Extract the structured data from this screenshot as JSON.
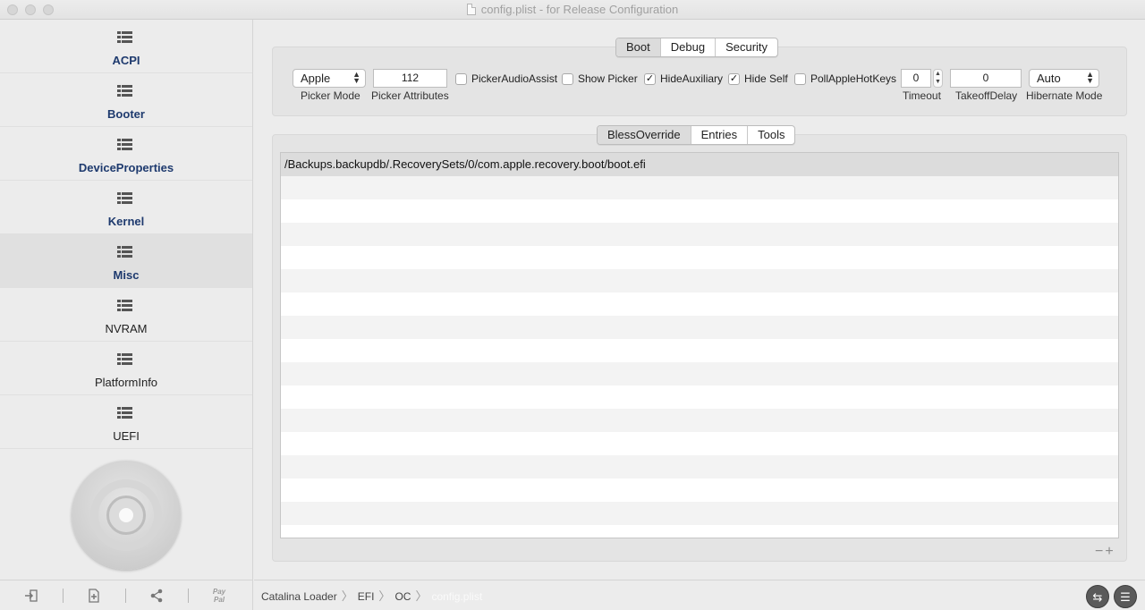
{
  "window": {
    "title": "config.plist - for Release Configuration"
  },
  "sidebar": {
    "items": [
      {
        "label": "ACPI"
      },
      {
        "label": "Booter"
      },
      {
        "label": "DeviceProperties"
      },
      {
        "label": "Kernel"
      },
      {
        "label": "Misc"
      },
      {
        "label": "NVRAM"
      },
      {
        "label": "PlatformInfo"
      },
      {
        "label": "UEFI"
      }
    ],
    "active_index": 4,
    "toolbar": {
      "paypal_line1": "Pay",
      "paypal_line2": "Pal"
    }
  },
  "top_tabs": {
    "items": [
      "Boot",
      "Debug",
      "Security"
    ],
    "selected": "Boot"
  },
  "boot": {
    "picker_mode": {
      "value": "Apple",
      "caption": "Picker Mode"
    },
    "picker_attributes": {
      "value": "112",
      "caption": "Picker Attributes"
    },
    "checkboxes": [
      {
        "label": "PickerAudioAssist",
        "checked": false
      },
      {
        "label": "Show Picker",
        "checked": false
      },
      {
        "label": "HideAuxiliary",
        "checked": true
      },
      {
        "label": "Hide Self",
        "checked": true
      },
      {
        "label": "PollAppleHotKeys",
        "checked": false
      }
    ],
    "timeout": {
      "value": "0",
      "caption": "Timeout"
    },
    "takeoff_delay": {
      "value": "0",
      "caption": "TakeoffDelay"
    },
    "hibernate_mode": {
      "value": "Auto",
      "caption": "Hibernate Mode"
    }
  },
  "sub_tabs": {
    "items": [
      "BlessOverride",
      "Entries",
      "Tools"
    ],
    "selected": "BlessOverride"
  },
  "table": {
    "rows": [
      "/Backups.backupdb/.RecoverySets/0/com.apple.recovery.boot/boot.efi"
    ],
    "empty_rows": 15
  },
  "table_controls": {
    "remove": "−",
    "add": "+"
  },
  "path": {
    "crumbs": [
      "Catalina Loader",
      "EFI",
      "OC",
      "config.plist"
    ],
    "separator": "〉"
  },
  "checkmark": "✓"
}
